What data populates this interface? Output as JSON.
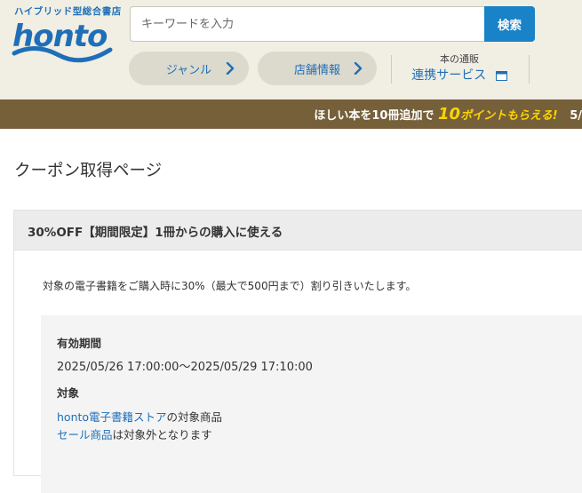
{
  "header": {
    "tagline": "ハイブリッド型総合書店",
    "logo_text": "honto",
    "search": {
      "placeholder": "キーワードを入力",
      "value": "",
      "button_label": "検索"
    },
    "nav": [
      {
        "label": "ジャンル"
      },
      {
        "label": "店舗情報"
      }
    ],
    "linkage": {
      "small_label": "本の通販",
      "main_label": "連携サービス"
    }
  },
  "banner": {
    "prefix": "ほしい本を10冊追加で",
    "points": "10",
    "suffix": "ポイントもらえる!",
    "extra": "5/"
  },
  "page_title": "クーポン取得ページ",
  "coupon": {
    "title": "30%OFF【期間限定】1冊からの購入に使える",
    "description": "対象の電子書籍をご購入時に30%（最大で500円まで）割り引きいたします。",
    "validity_label": "有効期間",
    "validity_value": "2025/05/26 17:00:00～2025/05/29 17:10:00",
    "target_label": "対象",
    "target_link": "honto電子書籍ストア",
    "target_suffix": "の対象商品",
    "exclusion_link": "セール商品",
    "exclusion_suffix": "は対象外となります"
  },
  "colors": {
    "brand_blue": "#1f6fb8",
    "header_bg": "#f1eee3",
    "banner_bg": "#76603a",
    "banner_accent": "#ffd400",
    "search_button": "#1a82c7"
  }
}
